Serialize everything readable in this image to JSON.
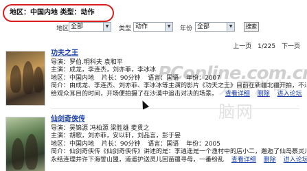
{
  "filter_tag": "地区：中国内地 类型：动作",
  "filters": {
    "region_label": "地区",
    "region_value": "全部",
    "type_label": "类型",
    "type_value": "动作",
    "year_label": "年份",
    "year_value": "全部",
    "search_button": "搜索"
  },
  "pager": {
    "prev": "上一页",
    "page_info": "1/225",
    "next": "下一页"
  },
  "movies": [
    {
      "title": "功夫之王",
      "director": "导演：罗伯.明科夫 袁和平",
      "cast": "主演：成龙，李连杰，刘亦菲，李冰冰",
      "region_line": "地区：中国内地",
      "length": "片长：90分钟",
      "language": "语言：国语",
      "year": "年份：2007",
      "synopsis_1": "简介：由成龙、李连杰、刘亦菲、李冰冰等主演的影片《功夫之王》目前在新疆北疆开拍，不过影片有何新奇亮点呢？",
      "synopsis_2": "给观众耳目的时间，开场便拍摄了在沙漠中追击对决的场景。",
      "details": "查看详细",
      "delete": "删除",
      "forum": "进入论坛"
    },
    {
      "title": "仙剑奇侠传",
      "director": "导演：吴锦源 冯柏源 梁胜雄 麦贯之",
      "cast": "主演：胡歌，刘亦菲，安以轩，刘品言，彭于晏",
      "region_line": "地区：中国内地",
      "length": "片长：90分钟",
      "language": "语言：国语",
      "year": "年份：2005",
      "synopsis_1": "简介：仙剑奇侠传《仙剑奇侠传》讲述的是：李逍遥是一个渔村中的店小二，邂逅了仙岛蔡灵儿，从此踏上寻找",
      "synopsis_2": "永结连理并许下海誓山盟，道遥护送灵儿回苗疆寻母，一番纷乱",
      "details": "查看详细",
      "delete": "删除",
      "forum": "进入论坛"
    }
  ],
  "watermark": "PConline.com.cn",
  "watermark_cn": "太平洋电脑网"
}
